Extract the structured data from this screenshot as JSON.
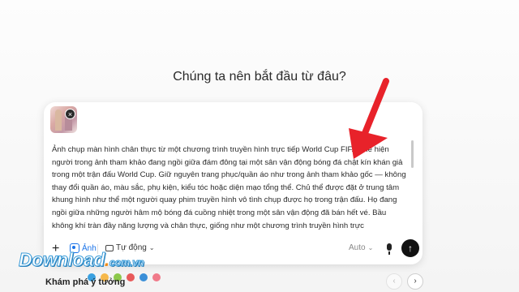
{
  "heading": "Chúng ta nên bắt đầu từ đâu?",
  "prompt": {
    "text": "Ảnh chụp màn hình chân thực từ một chương trình truyền hình trực tiếp World Cup FIFA, thể hiện người trong ảnh tham khảo đang ngồi giữa đám đông tại một sân vận động bóng đá chật kín khán giả trong một trận đấu World Cup. Giữ nguyên trang phục/quần áo như trong ảnh tham khảo gốc — không thay đổi quần áo, màu sắc, phụ kiện, kiểu tóc hoặc diện mạo tổng thể. Chủ thể được đặt ở trung tâm khung hình như thể một người quay phim truyền hình vô tình chụp được họ trong trận đấu. Họ đang ngồi giữa những người hâm mộ bóng đá cuồng nhiệt trong một sân vận động đã bán hết vé. Bầu không khí tràn đầy năng lượng và chân thực, giống như một chương trình truyền hình trực",
    "attachment_close": "×"
  },
  "toolbar": {
    "plus": "+",
    "image_label": "Ảnh",
    "mode_label": "Tự động",
    "aspect_label": "Auto",
    "send": "↑",
    "chevron": "⌄"
  },
  "watermark": {
    "name": "Download",
    "dot": ".",
    "tld": "com.vn",
    "dot_colors": [
      "#3aa0e0",
      "#f6b84a",
      "#8cc84b",
      "#e85a5a",
      "#3a8fd8",
      "#f07a8a"
    ]
  },
  "explore": {
    "label": "Khám phá ý tưởng",
    "prev": "‹",
    "next": "›"
  },
  "colors": {
    "accent": "#1a73e8",
    "arrow": "#e8222a",
    "send_bg": "#111111"
  }
}
